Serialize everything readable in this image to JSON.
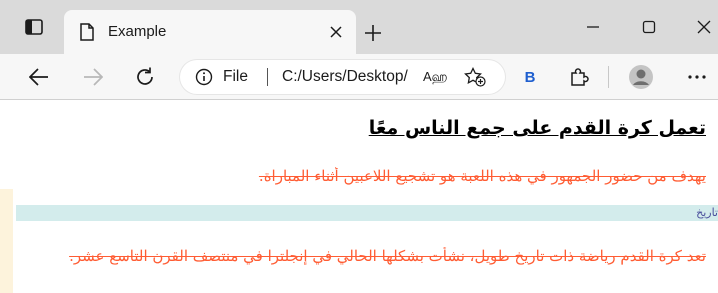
{
  "browser": {
    "tab_title": "Example",
    "address_info_label": "File",
    "address_url": "C:/Users/Desktop/",
    "address_read_aloud": "Aஹ",
    "extension_label": "B",
    "icons": [
      "tab-actions-icon",
      "page-icon",
      "close-icon",
      "new-tab-icon",
      "minimize-icon",
      "maximize-icon",
      "window-close-icon",
      "back-icon",
      "forward-icon",
      "refresh-icon",
      "info-icon",
      "add-favorite-icon",
      "extensions-icon",
      "profile-icon",
      "more-icon"
    ]
  },
  "page": {
    "heading": "تعمل كرة القدم على جمع الناس معًا",
    "paragraph_1": "يهدف من حضور الجمهور في هذه اللعبة هو تشجيع اللاعبين أثناء المباراة.",
    "band_label": "تاريخ",
    "paragraph_3": "تعد كرة القدم رياضة ذات تاريخ طويل، نشأت بشكلها الحالي في إنجلترا في منتصف القرن التاسع عشر.",
    "colors": {
      "paragraph_text": "#ff5c33",
      "band_background": "#d3ecec",
      "band_text": "#4a4f9c",
      "side_tint": "#fdf3dc"
    }
  }
}
